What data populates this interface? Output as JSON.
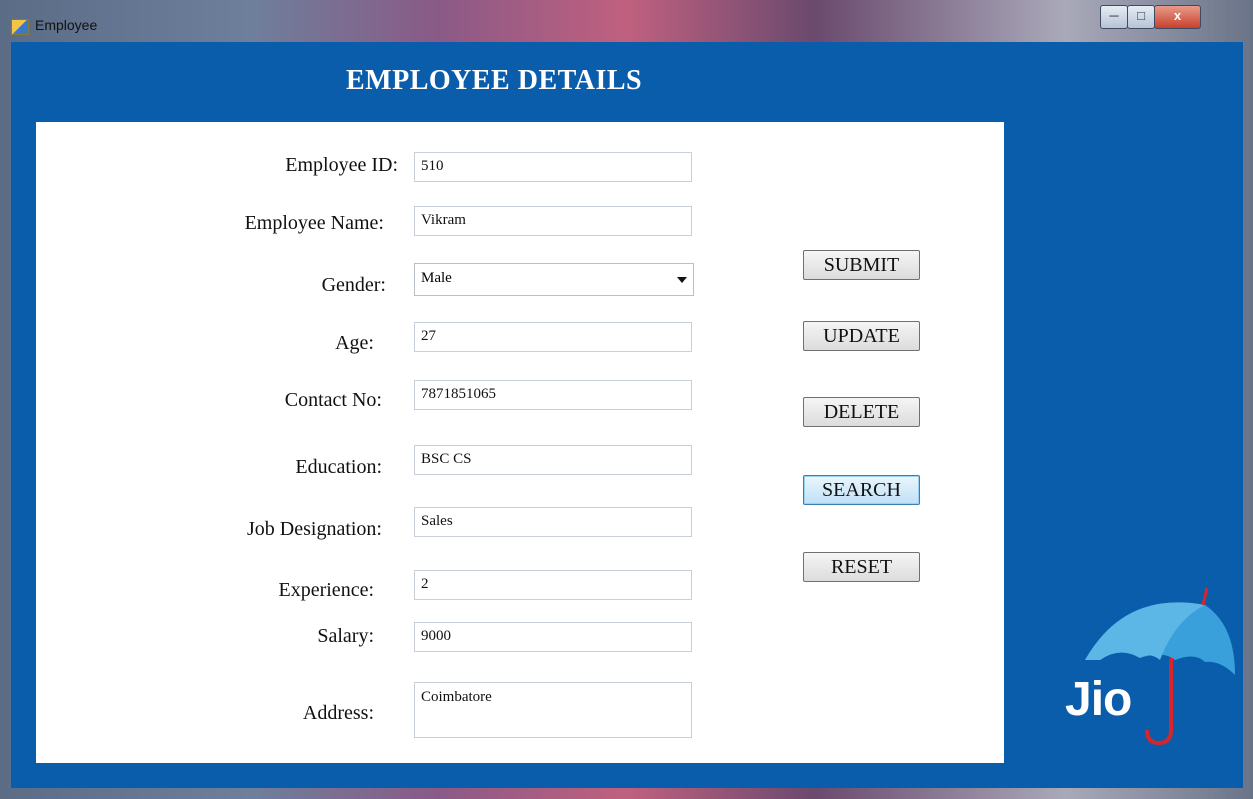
{
  "window": {
    "title": "Employee",
    "controls": {
      "minimize": "─",
      "maximize": "□",
      "close": "x"
    }
  },
  "heading": "EMPLOYEE DETAILS",
  "form": {
    "employee_id": {
      "label": "Employee ID:",
      "value": "510"
    },
    "employee_name": {
      "label": "Employee Name:",
      "value": "Vikram"
    },
    "gender": {
      "label": "Gender:",
      "value": "Male"
    },
    "age": {
      "label": "Age:",
      "value": "27"
    },
    "contact_no": {
      "label": "Contact No:",
      "value": "7871851065"
    },
    "education": {
      "label": "Education:",
      "value": "BSC CS"
    },
    "job_designation": {
      "label": "Job Designation:",
      "value": "Sales"
    },
    "experience": {
      "label": "Experience:",
      "value": "2"
    },
    "salary": {
      "label": "Salary:",
      "value": "9000"
    },
    "address": {
      "label": "Address:",
      "value": "Coimbatore"
    }
  },
  "buttons": {
    "submit": "SUBMIT",
    "update": "UPDATE",
    "delete": "DELETE",
    "search": "SEARCH",
    "reset": "RESET"
  },
  "logo": {
    "text": "Jio"
  },
  "colors": {
    "client_bg": "#0a5daa",
    "panel_bg": "#ffffff",
    "logo_blue": "#3aa0dc",
    "logo_red": "#d6262c"
  }
}
